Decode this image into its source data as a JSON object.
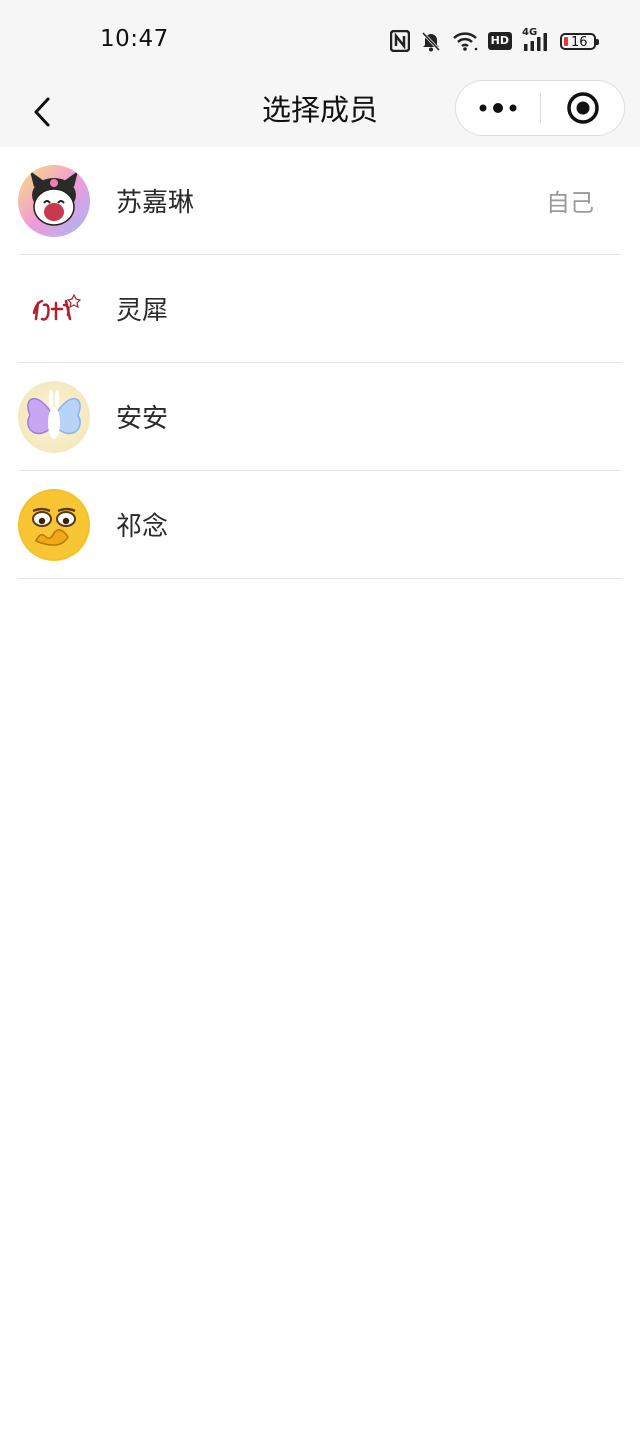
{
  "status_bar": {
    "time": "10:47",
    "icons": [
      "nfc-icon",
      "mute-bell-icon",
      "wifi-icon",
      "hd-icon",
      "4g-signal-icon",
      "battery-icon"
    ],
    "hd_label": "HD",
    "network_label": "4G",
    "battery_level": "16",
    "battery_color": "#e53935"
  },
  "nav": {
    "title": "选择成员",
    "back_icon": "chevron-left-icon",
    "more_icon": "more-dots-icon",
    "close_icon": "target-close-icon"
  },
  "members": [
    {
      "name": "苏嘉琳",
      "tag": "自己",
      "avatar": "kuromi-avatar"
    },
    {
      "name": "灵犀",
      "tag": "",
      "avatar": "text-logo-avatar"
    },
    {
      "name": "安安",
      "tag": "",
      "avatar": "butterfly-bunny-avatar"
    },
    {
      "name": "祁念",
      "tag": "",
      "avatar": "emoji-face-avatar"
    }
  ],
  "colors": {
    "header_bg": "#f6f6f6",
    "page_bg": "#ffffff",
    "divider": "#e6e6e6",
    "tag_text": "#9a9a9a"
  }
}
